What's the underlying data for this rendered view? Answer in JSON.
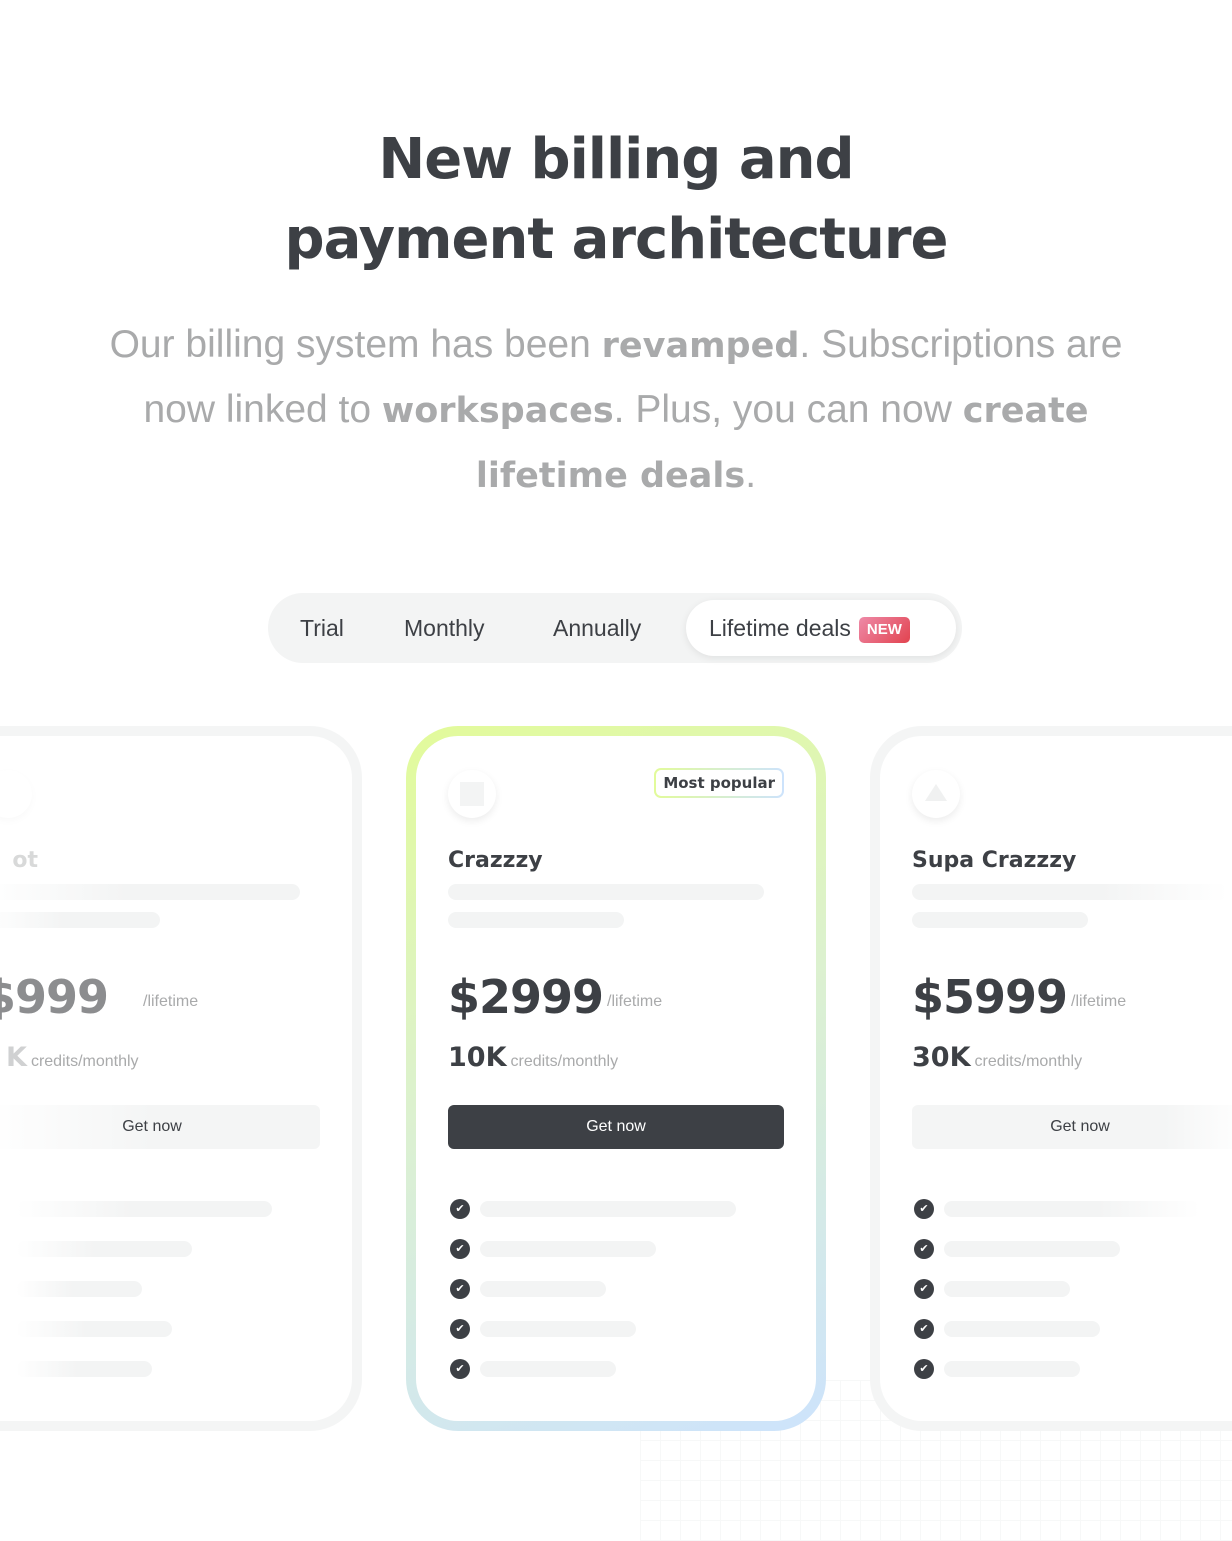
{
  "header": {
    "title_line1": "New billing and",
    "title_line2": "payment architecture",
    "subtitle": {
      "p1": "Our billing system has been ",
      "b1": "revamped",
      "p2": ". Subscriptions are now linked to ",
      "b2": "workspaces",
      "p3": ". Plus, you can now ",
      "b3": "create lifetime deals",
      "p4": "."
    }
  },
  "tabs": [
    {
      "label": "Trial"
    },
    {
      "label": "Monthly"
    },
    {
      "label": "Annually"
    },
    {
      "label": "Lifetime deals",
      "badge": "NEW",
      "active": true
    }
  ],
  "plans": [
    {
      "name": "ot",
      "price": "$999",
      "period": "/lifetime",
      "credits": "K",
      "credits_label": "credits/monthly",
      "cta": "Get now",
      "icon": "circle-icon"
    },
    {
      "name": "Crazzzy",
      "price": "$2999",
      "period": "/lifetime",
      "credits": "10K",
      "credits_label": "credits/monthly",
      "cta": "Get now",
      "badge": "Most popular",
      "icon": "square-icon"
    },
    {
      "name": "Supa Crazzzy",
      "price": "$5999",
      "period": "/lifetime",
      "credits": "30K",
      "credits_label": "credits/monthly",
      "cta": "Get now",
      "icon": "triangle-icon"
    }
  ],
  "colors": {
    "text": "#3d4045",
    "muted": "#a9aaab",
    "badge_new": "#e2434f",
    "highlight_gradient": [
      "#e2fb9a",
      "#cde3fc"
    ]
  }
}
